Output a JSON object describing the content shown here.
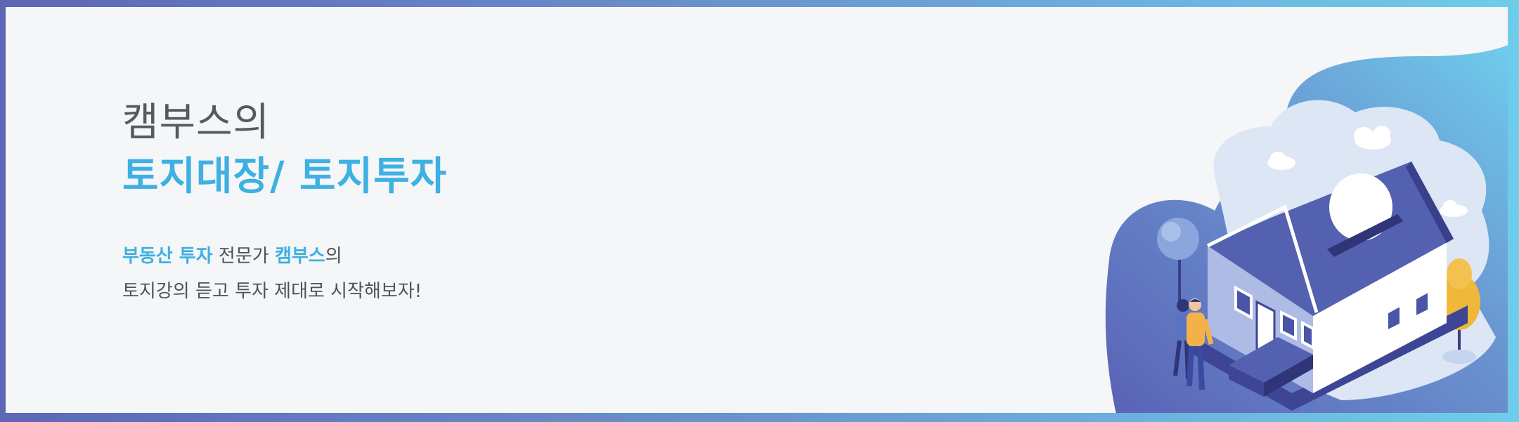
{
  "banner": {
    "title_line1": "캠부스의",
    "title_line2": "토지대장/ 토지투자",
    "desc_line1": {
      "hl1": "부동산 투자",
      "plain1": " 전문가 ",
      "hl2": "캠부스",
      "plain2": "의"
    },
    "desc_line2": "토지강의 듣고 투자 제대로 시작해보자!"
  },
  "colors": {
    "accent": "#3eb0e2",
    "text_dark": "#555a60",
    "background": "#f4f6f8",
    "frame_start": "#5d67b5",
    "frame_end": "#6ecdeb"
  }
}
